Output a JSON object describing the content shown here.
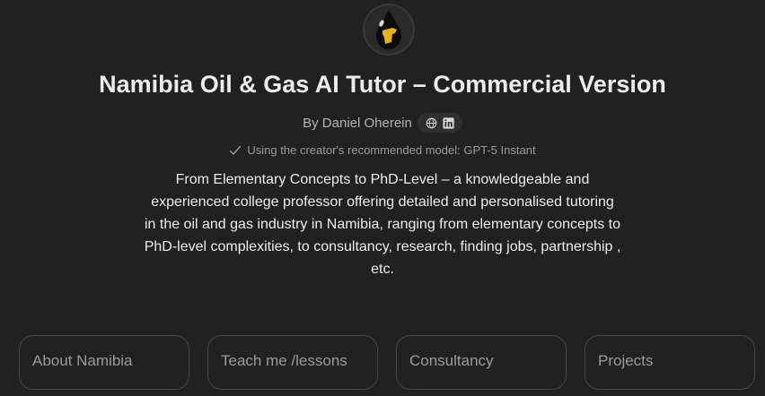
{
  "gpt": {
    "avatar_icon": "oil-drop-namibia-map-icon",
    "title": "Namibia Oil & Gas AI Tutor – Commercial Version",
    "author": "By Daniel Oherein",
    "social_icons": [
      "globe-icon",
      "linkedin-icon"
    ],
    "model_note": "Using the creator's recommended model: GPT-5 Instant",
    "description": "From Elementary Concepts to PhD-Level – a knowledgeable and experienced college professor offering detailed and personalised tutoring in the oil and gas industry in Namibia, ranging from elementary concepts to PhD-level complexities, to consultancy, research, finding jobs, partnership , etc."
  },
  "conversation_starters": [
    {
      "label": "About Namibia"
    },
    {
      "label": "Teach me /lessons"
    },
    {
      "label": "Consultancy"
    },
    {
      "label": "Projects"
    }
  ],
  "colors": {
    "background": "#212121",
    "card_border": "#484848",
    "text_primary": "#ececec",
    "text_secondary": "#b4b4b4",
    "avatar_gold": "#e8b21c"
  }
}
